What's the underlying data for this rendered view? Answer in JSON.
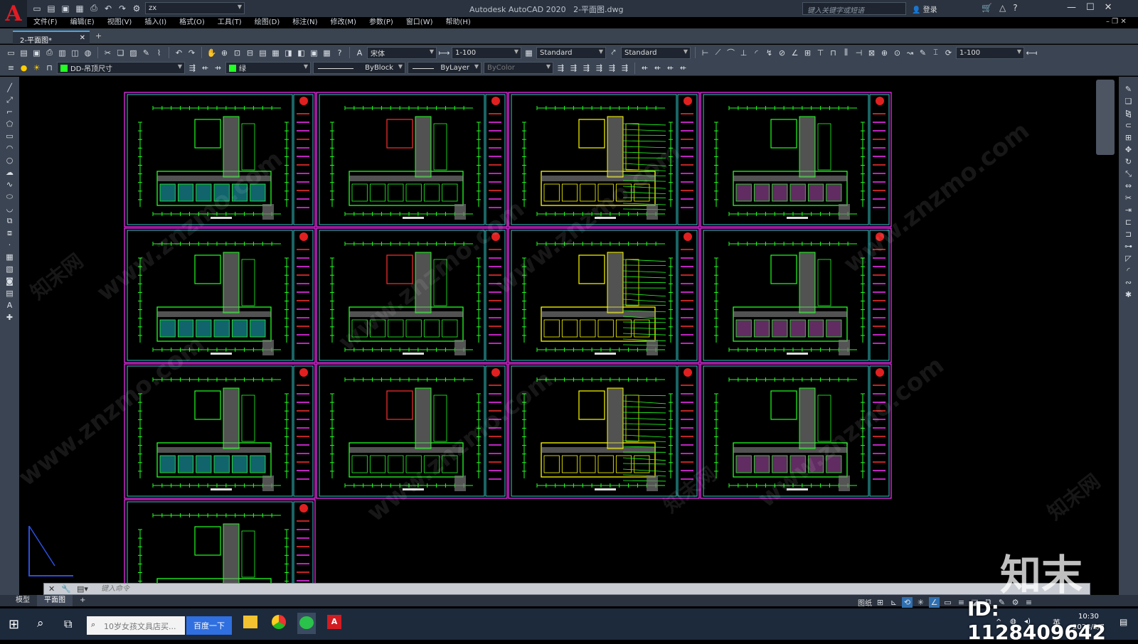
{
  "app": {
    "title": "Autodesk AutoCAD 2020",
    "file": "2-平面图.dwg",
    "workspace": "zx",
    "search_placeholder": "键入关键字或短语",
    "login": "登录"
  },
  "menus": [
    "文件(F)",
    "编辑(E)",
    "视图(V)",
    "插入(I)",
    "格式(O)",
    "工具(T)",
    "绘图(D)",
    "标注(N)",
    "修改(M)",
    "参数(P)",
    "窗口(W)",
    "帮助(H)"
  ],
  "doc_tab": "2-平面图*",
  "toolbar1": {
    "font": "宋体",
    "dimscale": "1-100",
    "textstyle": "Standard",
    "dimstyle": "Standard",
    "scale2": "1-100"
  },
  "toolbar2": {
    "layer": "DD-吊顶尺寸",
    "color_name": "绿",
    "linetype": "ByBlock",
    "lineweight": "ByLayer",
    "plotstyle": "ByColor"
  },
  "command": {
    "placeholder": "键入命令"
  },
  "layout_tabs": [
    "模型",
    "平面图"
  ],
  "status": {
    "paper": "图纸"
  },
  "taskbar": {
    "search_text": "10岁女孩文具店买...",
    "baidu": "百度一下",
    "ime": "英",
    "time": "10:30",
    "date": "2023/2/7"
  },
  "watermark": {
    "brand": "知末",
    "site": "www.znzmo.com",
    "site2": "知末网",
    "id": "ID: 1128409642"
  },
  "colors": {
    "accent": "#4aa3df",
    "sheet_border": "#ff2fff",
    "frame": "#35c8c8",
    "line_green": "#22ff22",
    "line_yellow": "#ffff00",
    "line_red": "#ff3030"
  }
}
